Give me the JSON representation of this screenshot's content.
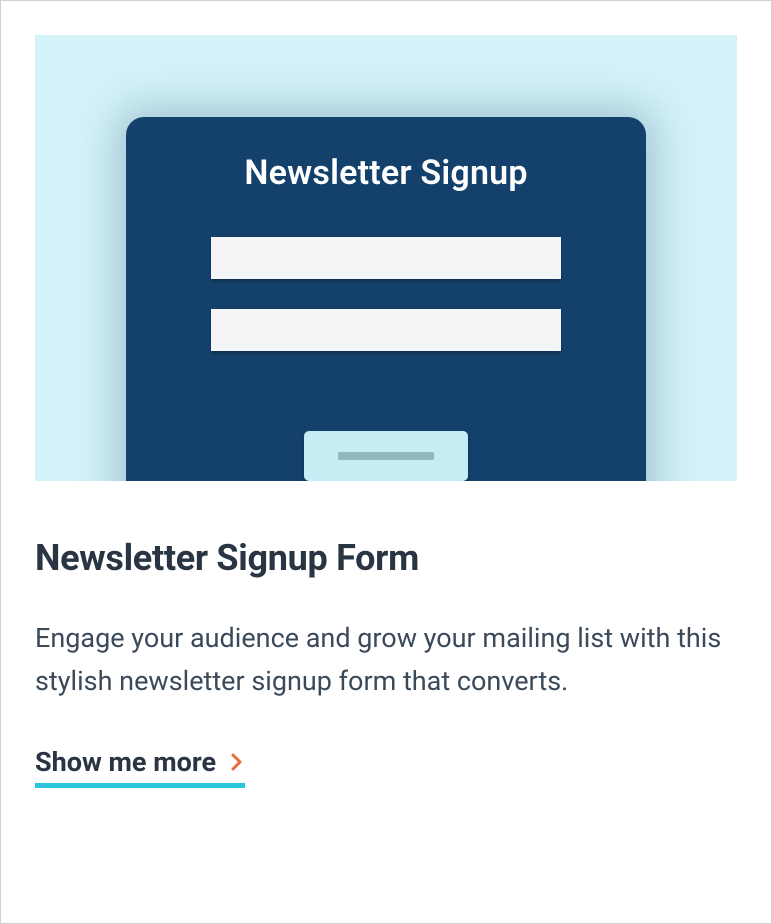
{
  "thumbnail": {
    "form_title": "Newsletter Signup"
  },
  "card": {
    "title": "Newsletter Signup Form",
    "description": "Engage your audience and grow your mailing list with this stylish newsletter signup form that converts.",
    "cta_label": "Show me more"
  },
  "colors": {
    "accent_underline": "#2ac5d8",
    "chevron": "#e86a3f",
    "panel": "#14416b",
    "thumbnail_bg": "#d3f3f8"
  }
}
